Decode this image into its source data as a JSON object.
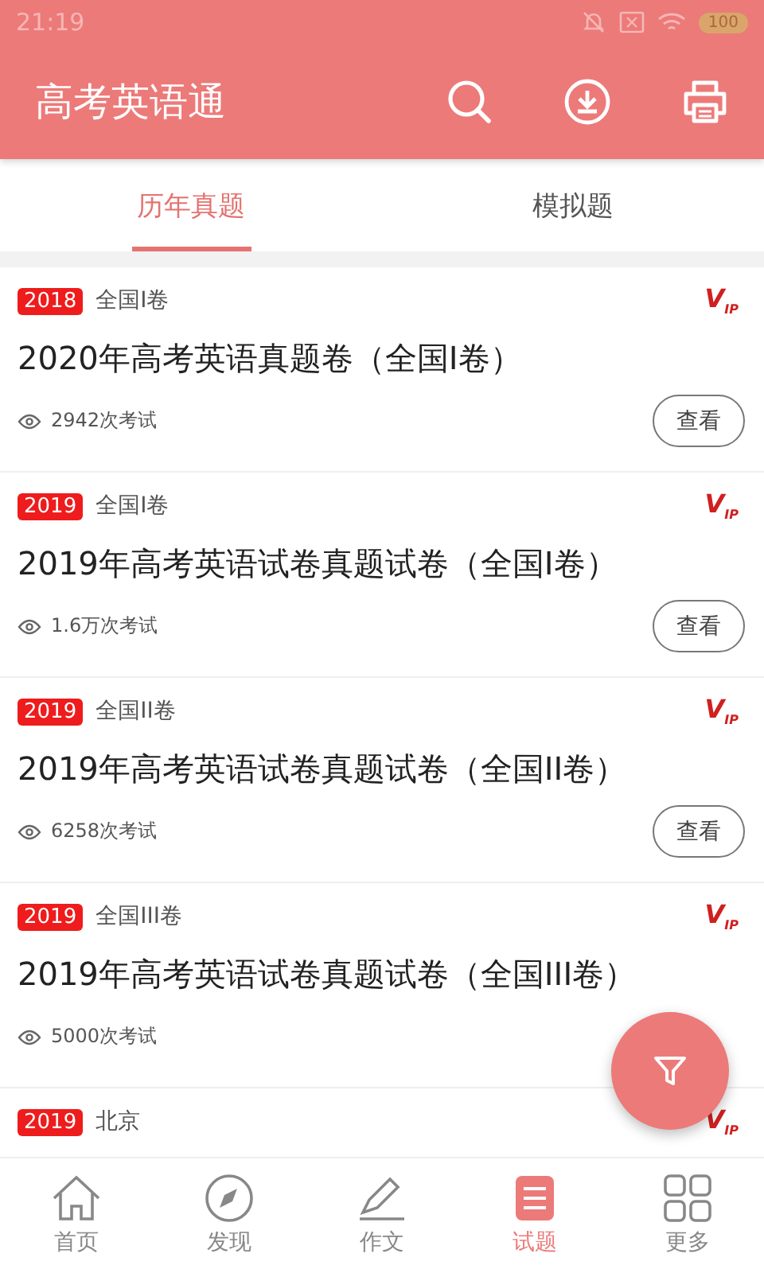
{
  "status_bar": {
    "time": "21:19",
    "battery": "100"
  },
  "app_bar": {
    "title": "高考英语通"
  },
  "tabs": [
    {
      "label": "历年真题",
      "selected": true
    },
    {
      "label": "模拟题",
      "selected": false
    }
  ],
  "papers": [
    {
      "year": "2018",
      "region": "全国I卷",
      "vip": "V$_{IP}$",
      "title": "2020年高考英语真题卷（全国I卷）",
      "count": "2942次考试",
      "button": "查看"
    },
    {
      "year": "2019",
      "region": "全国I卷",
      "vip": "V$_{IP}$",
      "title": "2019年高考英语试卷真题试卷（全国I卷）",
      "count": "1.6万次考试",
      "button": "查看"
    },
    {
      "year": "2019",
      "region": "全国II卷",
      "vip": "V$_{IP}$",
      "title": "2019年高考英语试卷真题试卷（全国II卷）",
      "count": "6258次考试",
      "button": "查看"
    },
    {
      "year": "2019",
      "region": "全国III卷",
      "vip": "V$_{IP}$",
      "title": "2019年高考英语试卷真题试卷（全国III卷）",
      "count": "5000次考试"
    },
    {
      "year": "2019",
      "region": "北京",
      "vip": "V$_{IP}$"
    }
  ],
  "bottom_nav": [
    {
      "label": "首页",
      "kind": "home",
      "selected": false
    },
    {
      "label": "发现",
      "kind": "compass",
      "selected": false
    },
    {
      "label": "作文",
      "kind": "pencil",
      "selected": false
    },
    {
      "label": "试题",
      "kind": "paper",
      "selected": true
    },
    {
      "label": "更多",
      "kind": "grid",
      "selected": false
    }
  ]
}
